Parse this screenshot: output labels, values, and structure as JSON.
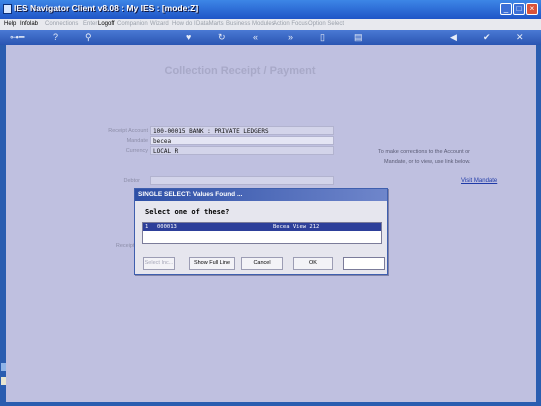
{
  "window": {
    "title": "IES Navigator Client v8.08 : My IES :      [mode:Z]"
  },
  "menu": [
    {
      "label": "Help",
      "dim": false
    },
    {
      "label": "Infolab",
      "dim": false
    },
    {
      "label": "Connections",
      "dim": true
    },
    {
      "label": "Enter",
      "dim": true
    },
    {
      "label": "Logoff",
      "dim": false
    },
    {
      "label": "Companion",
      "dim": true
    },
    {
      "label": "Wizard",
      "dim": true
    },
    {
      "label": "How do I",
      "dim": true
    },
    {
      "label": "DataMarts",
      "dim": true
    },
    {
      "label": "Business Modules",
      "dim": true
    },
    {
      "label": "Action Focus",
      "dim": true
    },
    {
      "label": "Option Select",
      "dim": true
    }
  ],
  "form": {
    "title": "Collection Receipt / Payment",
    "receipt_account_label": "Receipt Account",
    "receipt_account_value": "100-00015 BANK : PRIVATE LEDGERS",
    "mandate_label": "Mandate",
    "mandate_value": "becea",
    "currency_label": "Currency",
    "currency_value": "LOCAL R",
    "debtor_label": "Debtor",
    "receipt_label": "Receipt R",
    "hint_line1": "To make corrections to the Account or",
    "hint_line2": "Mandate, or to view, use link below.",
    "link_text": "Visit Mandate"
  },
  "dialog": {
    "title": "SINGLE SELECT: Values Found ...",
    "prompt": "Select one of these?",
    "row": {
      "index": "1",
      "code": "000013",
      "name": "Becea View 212"
    },
    "buttons": {
      "select": "Select Inc...",
      "full": "Show Full Line",
      "cancel": "Cancel",
      "ok": "OK"
    }
  }
}
